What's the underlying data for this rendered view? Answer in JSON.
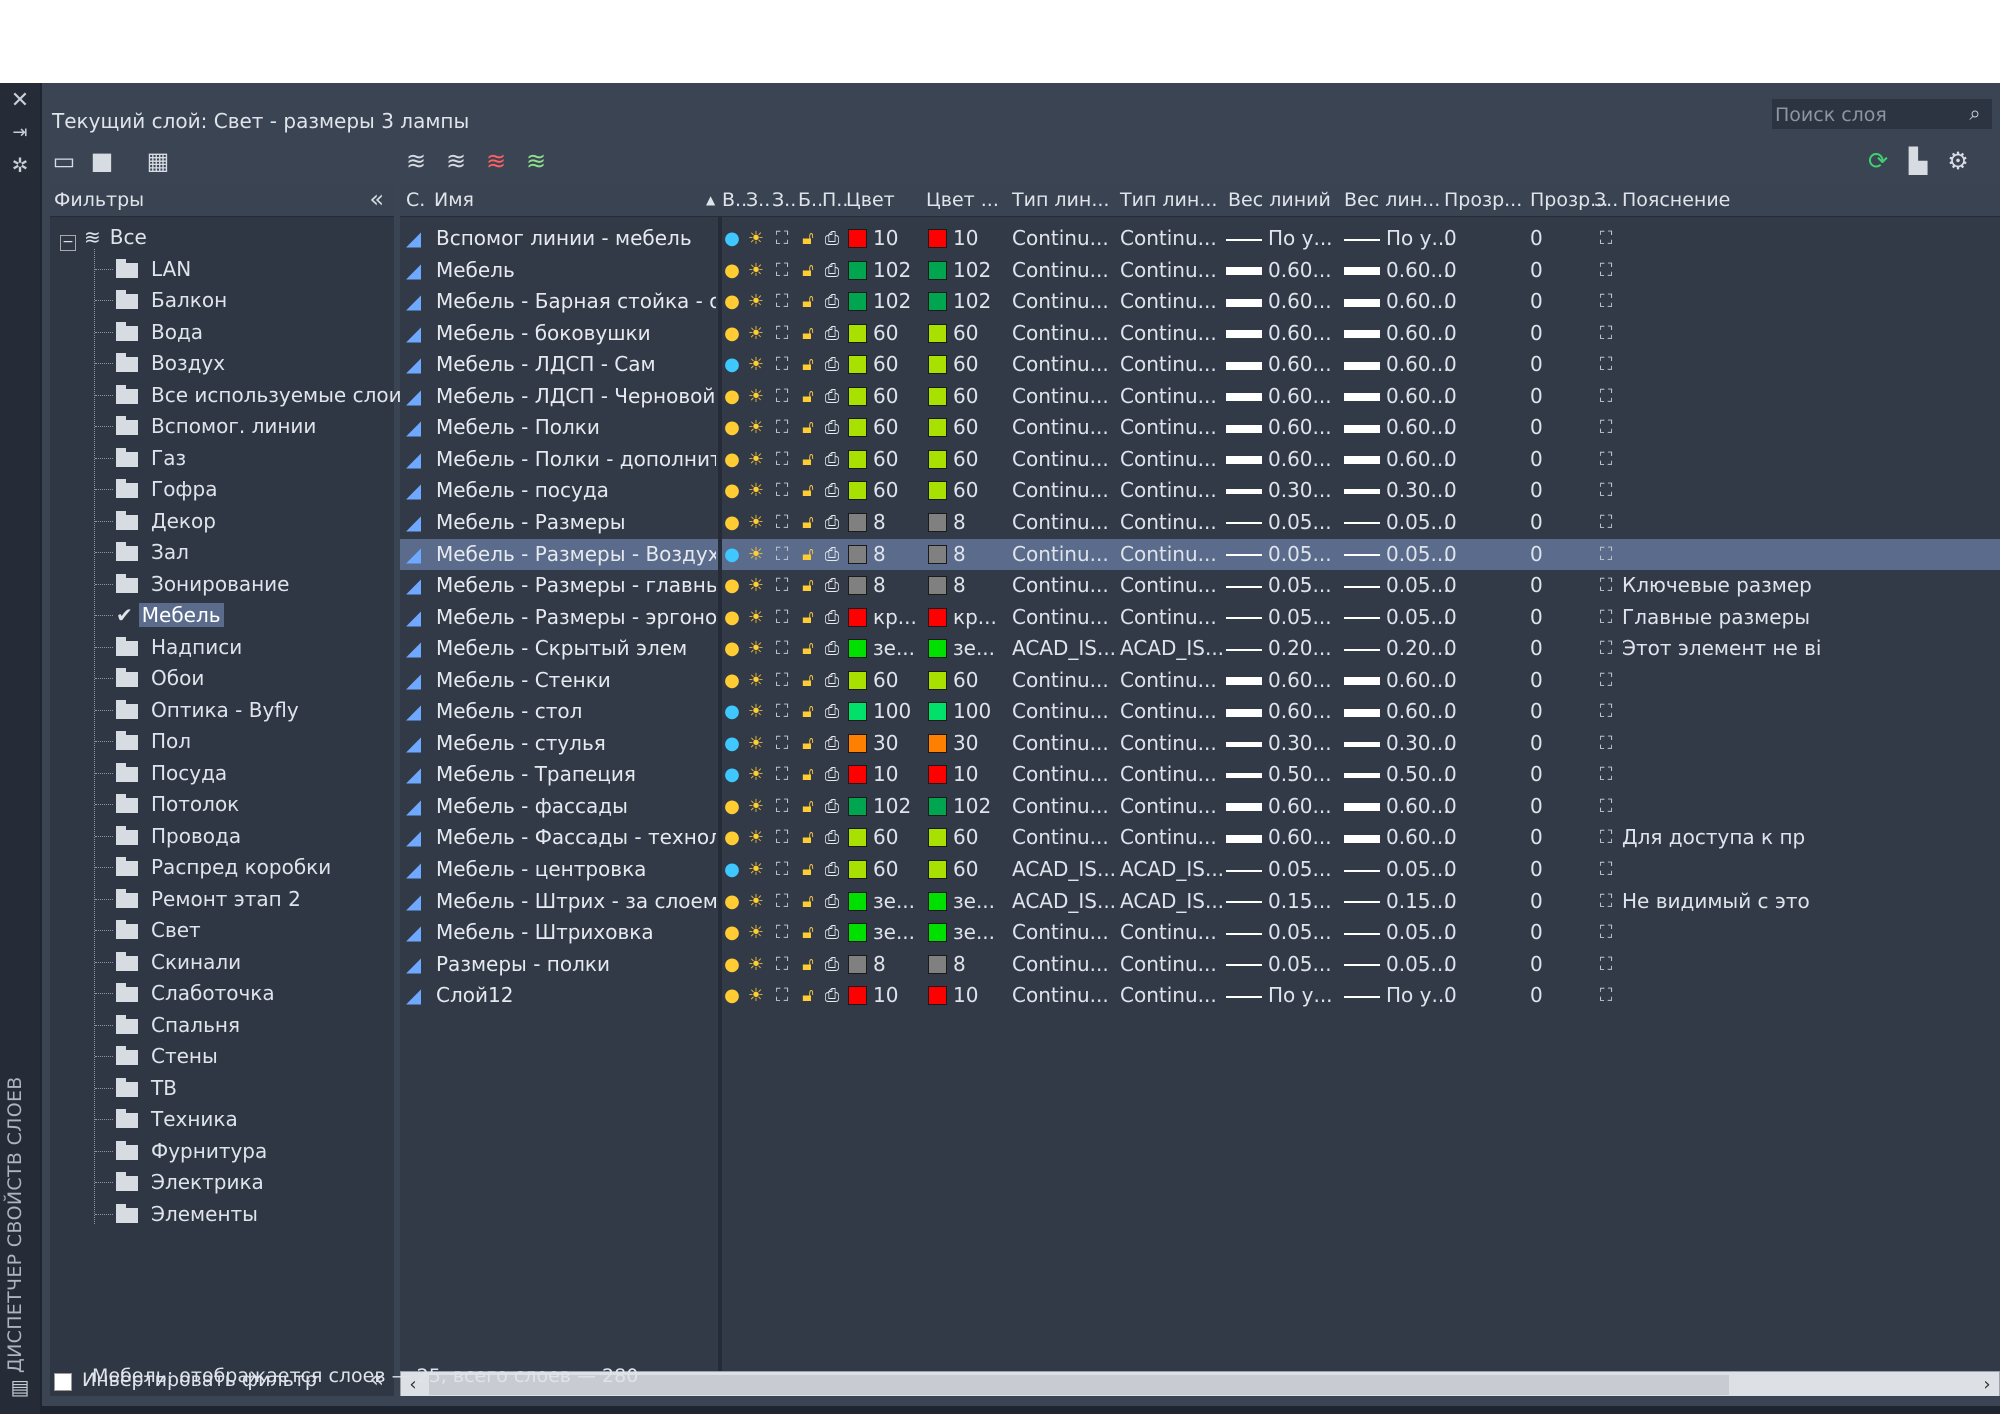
{
  "window": {
    "vertical_title": "ДИСПЕТЧЕР СВОЙСТВ СЛОЕВ",
    "side_buttons": [
      "close-icon",
      "pin-icon",
      "properties-icon"
    ],
    "current_layer_label": "Текущий слой: Свет - размеры 3 лампы",
    "search_placeholder": "Поиск слоя"
  },
  "toolbar": {
    "left_icons": [
      "new-property-filter-icon",
      "new-group-filter-icon",
      "layer-states-manager-icon"
    ],
    "layer_icons": [
      "new-layer-icon",
      "new-layer-frozen-vp-icon",
      "delete-layer-icon",
      "set-current-icon"
    ],
    "right_icons": [
      "refresh-icon",
      "layer-settings-icon",
      "gear-icon"
    ]
  },
  "filters": {
    "header": "Фильтры",
    "collapse_glyph": "«",
    "root": "Все",
    "items": [
      "LAN",
      "Балкон",
      "Вода",
      "Воздух",
      "Все используемые слои",
      "Вспомог. линии",
      "Газ",
      "Гофра",
      "Декор",
      "Зал",
      "Зонирование",
      "Мебель",
      "Надписи",
      "Обои",
      "Оптика - Byfly",
      "Пол",
      "Посуда",
      "Потолок",
      "Провода",
      "Распред коробки",
      "Ремонт этап 2",
      "Свет",
      "Скинали",
      "Слаботочка",
      "Спальня",
      "Стены",
      "ТВ",
      "Техника",
      "Фурнитура",
      "Электрика",
      "Элементы"
    ],
    "selected": "Мебель",
    "invert_label": "Инвертировать фильтр"
  },
  "grid": {
    "headers": [
      "С.",
      "Имя",
      "В..",
      "З..",
      "З..",
      "Б..",
      "П..",
      "Цвет",
      "Цвет ...",
      "Тип лин...",
      "Тип лин...",
      "Вес линий",
      "Вес лин...",
      "Прозр...",
      "Прозр...",
      "З..",
      "Пояснение"
    ],
    "selected_row": 10,
    "rows": [
      {
        "name": "Вспомог линии - мебель",
        "on": "cyan",
        "color": "#ff0000",
        "c": "10",
        "lt": "Continu...",
        "lw": "По у...",
        "lwt": "thin",
        "tr": "0",
        "d": ""
      },
      {
        "name": "Мебель",
        "on": "yellow",
        "color": "#00a550",
        "c": "102",
        "lt": "Continu...",
        "lw": "0.60...",
        "lwt": "thick",
        "tr": "0",
        "d": ""
      },
      {
        "name": "Мебель - Барная стойка - отверст...",
        "on": "yellow",
        "color": "#00a550",
        "c": "102",
        "lt": "Continu...",
        "lw": "0.60...",
        "lwt": "thick",
        "tr": "0",
        "d": ""
      },
      {
        "name": "Мебель - боковушки",
        "on": "yellow",
        "color": "#a8e000",
        "c": "60",
        "lt": "Continu...",
        "lw": "0.60...",
        "lwt": "thick",
        "tr": "0",
        "d": ""
      },
      {
        "name": "Мебель - ЛДСП - Сам",
        "on": "cyan",
        "color": "#a8e000",
        "c": "60",
        "lt": "Continu...",
        "lw": "0.60...",
        "lwt": "thick",
        "tr": "0",
        "d": ""
      },
      {
        "name": "Мебель - ЛДСП - Черновой",
        "on": "yellow",
        "color": "#a8e000",
        "c": "60",
        "lt": "Continu...",
        "lw": "0.60...",
        "lwt": "thick",
        "tr": "0",
        "d": ""
      },
      {
        "name": "Мебель - Полки",
        "on": "yellow",
        "color": "#a8e000",
        "c": "60",
        "lt": "Continu...",
        "lw": "0.60...",
        "lwt": "thick",
        "tr": "0",
        "d": ""
      },
      {
        "name": "Мебель - Полки - дополнительно...",
        "on": "yellow",
        "color": "#a8e000",
        "c": "60",
        "lt": "Continu...",
        "lw": "0.60...",
        "lwt": "thick",
        "tr": "0",
        "d": ""
      },
      {
        "name": "Мебель - посуда",
        "on": "yellow",
        "color": "#a8e000",
        "c": "60",
        "lt": "Continu...",
        "lw": "0.30...",
        "lwt": "mid",
        "tr": "0",
        "d": ""
      },
      {
        "name": "Мебель - Размеры",
        "on": "yellow",
        "color": "#808080",
        "c": "8",
        "lt": "Continu...",
        "lw": "0.05...",
        "lwt": "thin",
        "tr": "0",
        "d": ""
      },
      {
        "name": "Мебель - Размеры - Воздуховод",
        "on": "cyan",
        "color": "#808080",
        "c": "8",
        "lt": "Continu...",
        "lw": "0.05...",
        "lwt": "thin",
        "tr": "0",
        "d": ""
      },
      {
        "name": "Мебель - Размеры - главные",
        "on": "yellow",
        "color": "#808080",
        "c": "8",
        "lt": "Continu...",
        "lw": "0.05...",
        "lwt": "thin",
        "tr": "0",
        "d": "Ключевые размер"
      },
      {
        "name": "Мебель - Размеры - эргономика",
        "on": "yellow",
        "color": "#ff0000",
        "c": "кр...",
        "lt": "Continu...",
        "lw": "0.05...",
        "lwt": "thin",
        "tr": "0",
        "d": "Главные размеры"
      },
      {
        "name": "Мебель - Скрытый элем",
        "on": "yellow",
        "color": "#00e000",
        "c": "зе...",
        "lt": "ACAD_IS...",
        "lw": "0.20...",
        "lwt": "thin",
        "tr": "0",
        "d": "Этот элемент не ві"
      },
      {
        "name": "Мебель - Стенки",
        "on": "yellow",
        "color": "#a8e000",
        "c": "60",
        "lt": "Continu...",
        "lw": "0.60...",
        "lwt": "thick",
        "tr": "0",
        "d": ""
      },
      {
        "name": "Мебель - стол",
        "on": "cyan",
        "color": "#00e06a",
        "c": "100",
        "lt": "Continu...",
        "lw": "0.60...",
        "lwt": "thick",
        "tr": "0",
        "d": ""
      },
      {
        "name": "Мебель - стулья",
        "on": "cyan",
        "color": "#ff8000",
        "c": "30",
        "lt": "Continu...",
        "lw": "0.30...",
        "lwt": "mid",
        "tr": "0",
        "d": ""
      },
      {
        "name": "Мебель - Трапеция",
        "on": "cyan",
        "color": "#ff0000",
        "c": "10",
        "lt": "Continu...",
        "lw": "0.50...",
        "lwt": "mid",
        "tr": "0",
        "d": ""
      },
      {
        "name": "Мебель - фассады",
        "on": "yellow",
        "color": "#00a550",
        "c": "102",
        "lt": "Continu...",
        "lw": "0.60...",
        "lwt": "thick",
        "tr": "0",
        "d": ""
      },
      {
        "name": "Мебель - Фассады - технологичес...",
        "on": "yellow",
        "color": "#a8e000",
        "c": "60",
        "lt": "Continu...",
        "lw": "0.60...",
        "lwt": "thick",
        "tr": "0",
        "d": "Для доступа к пр"
      },
      {
        "name": "Мебель - центровка",
        "on": "cyan",
        "color": "#a8e000",
        "c": "60",
        "lt": "ACAD_IS...",
        "lw": "0.05...",
        "lwt": "thin",
        "tr": "0",
        "d": ""
      },
      {
        "name": "Мебель - Штрих - за слоем мебель",
        "on": "yellow",
        "color": "#00e000",
        "c": "зе...",
        "lt": "ACAD_IS...",
        "lw": "0.15...",
        "lwt": "thin",
        "tr": "0",
        "d": "Не видимый с это"
      },
      {
        "name": "Мебель - Штриховка",
        "on": "yellow",
        "color": "#00e000",
        "c": "зе...",
        "lt": "Continu...",
        "lw": "0.05...",
        "lwt": "thin",
        "tr": "0",
        "d": ""
      },
      {
        "name": "Размеры - полки",
        "on": "yellow",
        "color": "#808080",
        "c": "8",
        "lt": "Continu...",
        "lw": "0.05...",
        "lwt": "thin",
        "tr": "0",
        "d": ""
      },
      {
        "name": "Слой12",
        "on": "yellow",
        "color": "#ff0000",
        "c": "10",
        "lt": "Continu...",
        "lw": "По у...",
        "lwt": "thin",
        "tr": "0",
        "d": ""
      }
    ]
  },
  "status": "Мебель: отображается слоев — 25, всего слоев — 280"
}
